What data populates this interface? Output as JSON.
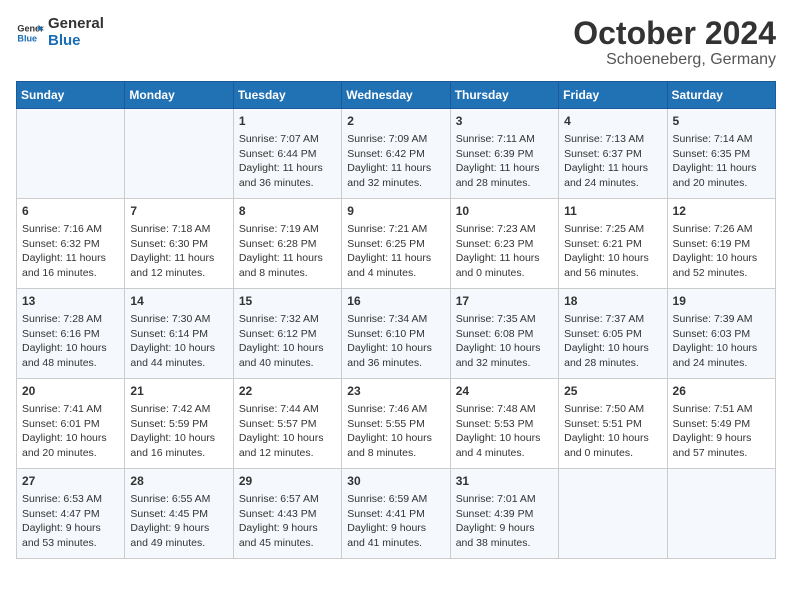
{
  "header": {
    "logo_line1": "General",
    "logo_line2": "Blue",
    "title": "October 2024",
    "subtitle": "Schoeneberg, Germany"
  },
  "weekdays": [
    "Sunday",
    "Monday",
    "Tuesday",
    "Wednesday",
    "Thursday",
    "Friday",
    "Saturday"
  ],
  "weeks": [
    [
      {
        "day": "",
        "info": ""
      },
      {
        "day": "",
        "info": ""
      },
      {
        "day": "1",
        "info": "Sunrise: 7:07 AM\nSunset: 6:44 PM\nDaylight: 11 hours and 36 minutes."
      },
      {
        "day": "2",
        "info": "Sunrise: 7:09 AM\nSunset: 6:42 PM\nDaylight: 11 hours and 32 minutes."
      },
      {
        "day": "3",
        "info": "Sunrise: 7:11 AM\nSunset: 6:39 PM\nDaylight: 11 hours and 28 minutes."
      },
      {
        "day": "4",
        "info": "Sunrise: 7:13 AM\nSunset: 6:37 PM\nDaylight: 11 hours and 24 minutes."
      },
      {
        "day": "5",
        "info": "Sunrise: 7:14 AM\nSunset: 6:35 PM\nDaylight: 11 hours and 20 minutes."
      }
    ],
    [
      {
        "day": "6",
        "info": "Sunrise: 7:16 AM\nSunset: 6:32 PM\nDaylight: 11 hours and 16 minutes."
      },
      {
        "day": "7",
        "info": "Sunrise: 7:18 AM\nSunset: 6:30 PM\nDaylight: 11 hours and 12 minutes."
      },
      {
        "day": "8",
        "info": "Sunrise: 7:19 AM\nSunset: 6:28 PM\nDaylight: 11 hours and 8 minutes."
      },
      {
        "day": "9",
        "info": "Sunrise: 7:21 AM\nSunset: 6:25 PM\nDaylight: 11 hours and 4 minutes."
      },
      {
        "day": "10",
        "info": "Sunrise: 7:23 AM\nSunset: 6:23 PM\nDaylight: 11 hours and 0 minutes."
      },
      {
        "day": "11",
        "info": "Sunrise: 7:25 AM\nSunset: 6:21 PM\nDaylight: 10 hours and 56 minutes."
      },
      {
        "day": "12",
        "info": "Sunrise: 7:26 AM\nSunset: 6:19 PM\nDaylight: 10 hours and 52 minutes."
      }
    ],
    [
      {
        "day": "13",
        "info": "Sunrise: 7:28 AM\nSunset: 6:16 PM\nDaylight: 10 hours and 48 minutes."
      },
      {
        "day": "14",
        "info": "Sunrise: 7:30 AM\nSunset: 6:14 PM\nDaylight: 10 hours and 44 minutes."
      },
      {
        "day": "15",
        "info": "Sunrise: 7:32 AM\nSunset: 6:12 PM\nDaylight: 10 hours and 40 minutes."
      },
      {
        "day": "16",
        "info": "Sunrise: 7:34 AM\nSunset: 6:10 PM\nDaylight: 10 hours and 36 minutes."
      },
      {
        "day": "17",
        "info": "Sunrise: 7:35 AM\nSunset: 6:08 PM\nDaylight: 10 hours and 32 minutes."
      },
      {
        "day": "18",
        "info": "Sunrise: 7:37 AM\nSunset: 6:05 PM\nDaylight: 10 hours and 28 minutes."
      },
      {
        "day": "19",
        "info": "Sunrise: 7:39 AM\nSunset: 6:03 PM\nDaylight: 10 hours and 24 minutes."
      }
    ],
    [
      {
        "day": "20",
        "info": "Sunrise: 7:41 AM\nSunset: 6:01 PM\nDaylight: 10 hours and 20 minutes."
      },
      {
        "day": "21",
        "info": "Sunrise: 7:42 AM\nSunset: 5:59 PM\nDaylight: 10 hours and 16 minutes."
      },
      {
        "day": "22",
        "info": "Sunrise: 7:44 AM\nSunset: 5:57 PM\nDaylight: 10 hours and 12 minutes."
      },
      {
        "day": "23",
        "info": "Sunrise: 7:46 AM\nSunset: 5:55 PM\nDaylight: 10 hours and 8 minutes."
      },
      {
        "day": "24",
        "info": "Sunrise: 7:48 AM\nSunset: 5:53 PM\nDaylight: 10 hours and 4 minutes."
      },
      {
        "day": "25",
        "info": "Sunrise: 7:50 AM\nSunset: 5:51 PM\nDaylight: 10 hours and 0 minutes."
      },
      {
        "day": "26",
        "info": "Sunrise: 7:51 AM\nSunset: 5:49 PM\nDaylight: 9 hours and 57 minutes."
      }
    ],
    [
      {
        "day": "27",
        "info": "Sunrise: 6:53 AM\nSunset: 4:47 PM\nDaylight: 9 hours and 53 minutes."
      },
      {
        "day": "28",
        "info": "Sunrise: 6:55 AM\nSunset: 4:45 PM\nDaylight: 9 hours and 49 minutes."
      },
      {
        "day": "29",
        "info": "Sunrise: 6:57 AM\nSunset: 4:43 PM\nDaylight: 9 hours and 45 minutes."
      },
      {
        "day": "30",
        "info": "Sunrise: 6:59 AM\nSunset: 4:41 PM\nDaylight: 9 hours and 41 minutes."
      },
      {
        "day": "31",
        "info": "Sunrise: 7:01 AM\nSunset: 4:39 PM\nDaylight: 9 hours and 38 minutes."
      },
      {
        "day": "",
        "info": ""
      },
      {
        "day": "",
        "info": ""
      }
    ]
  ]
}
